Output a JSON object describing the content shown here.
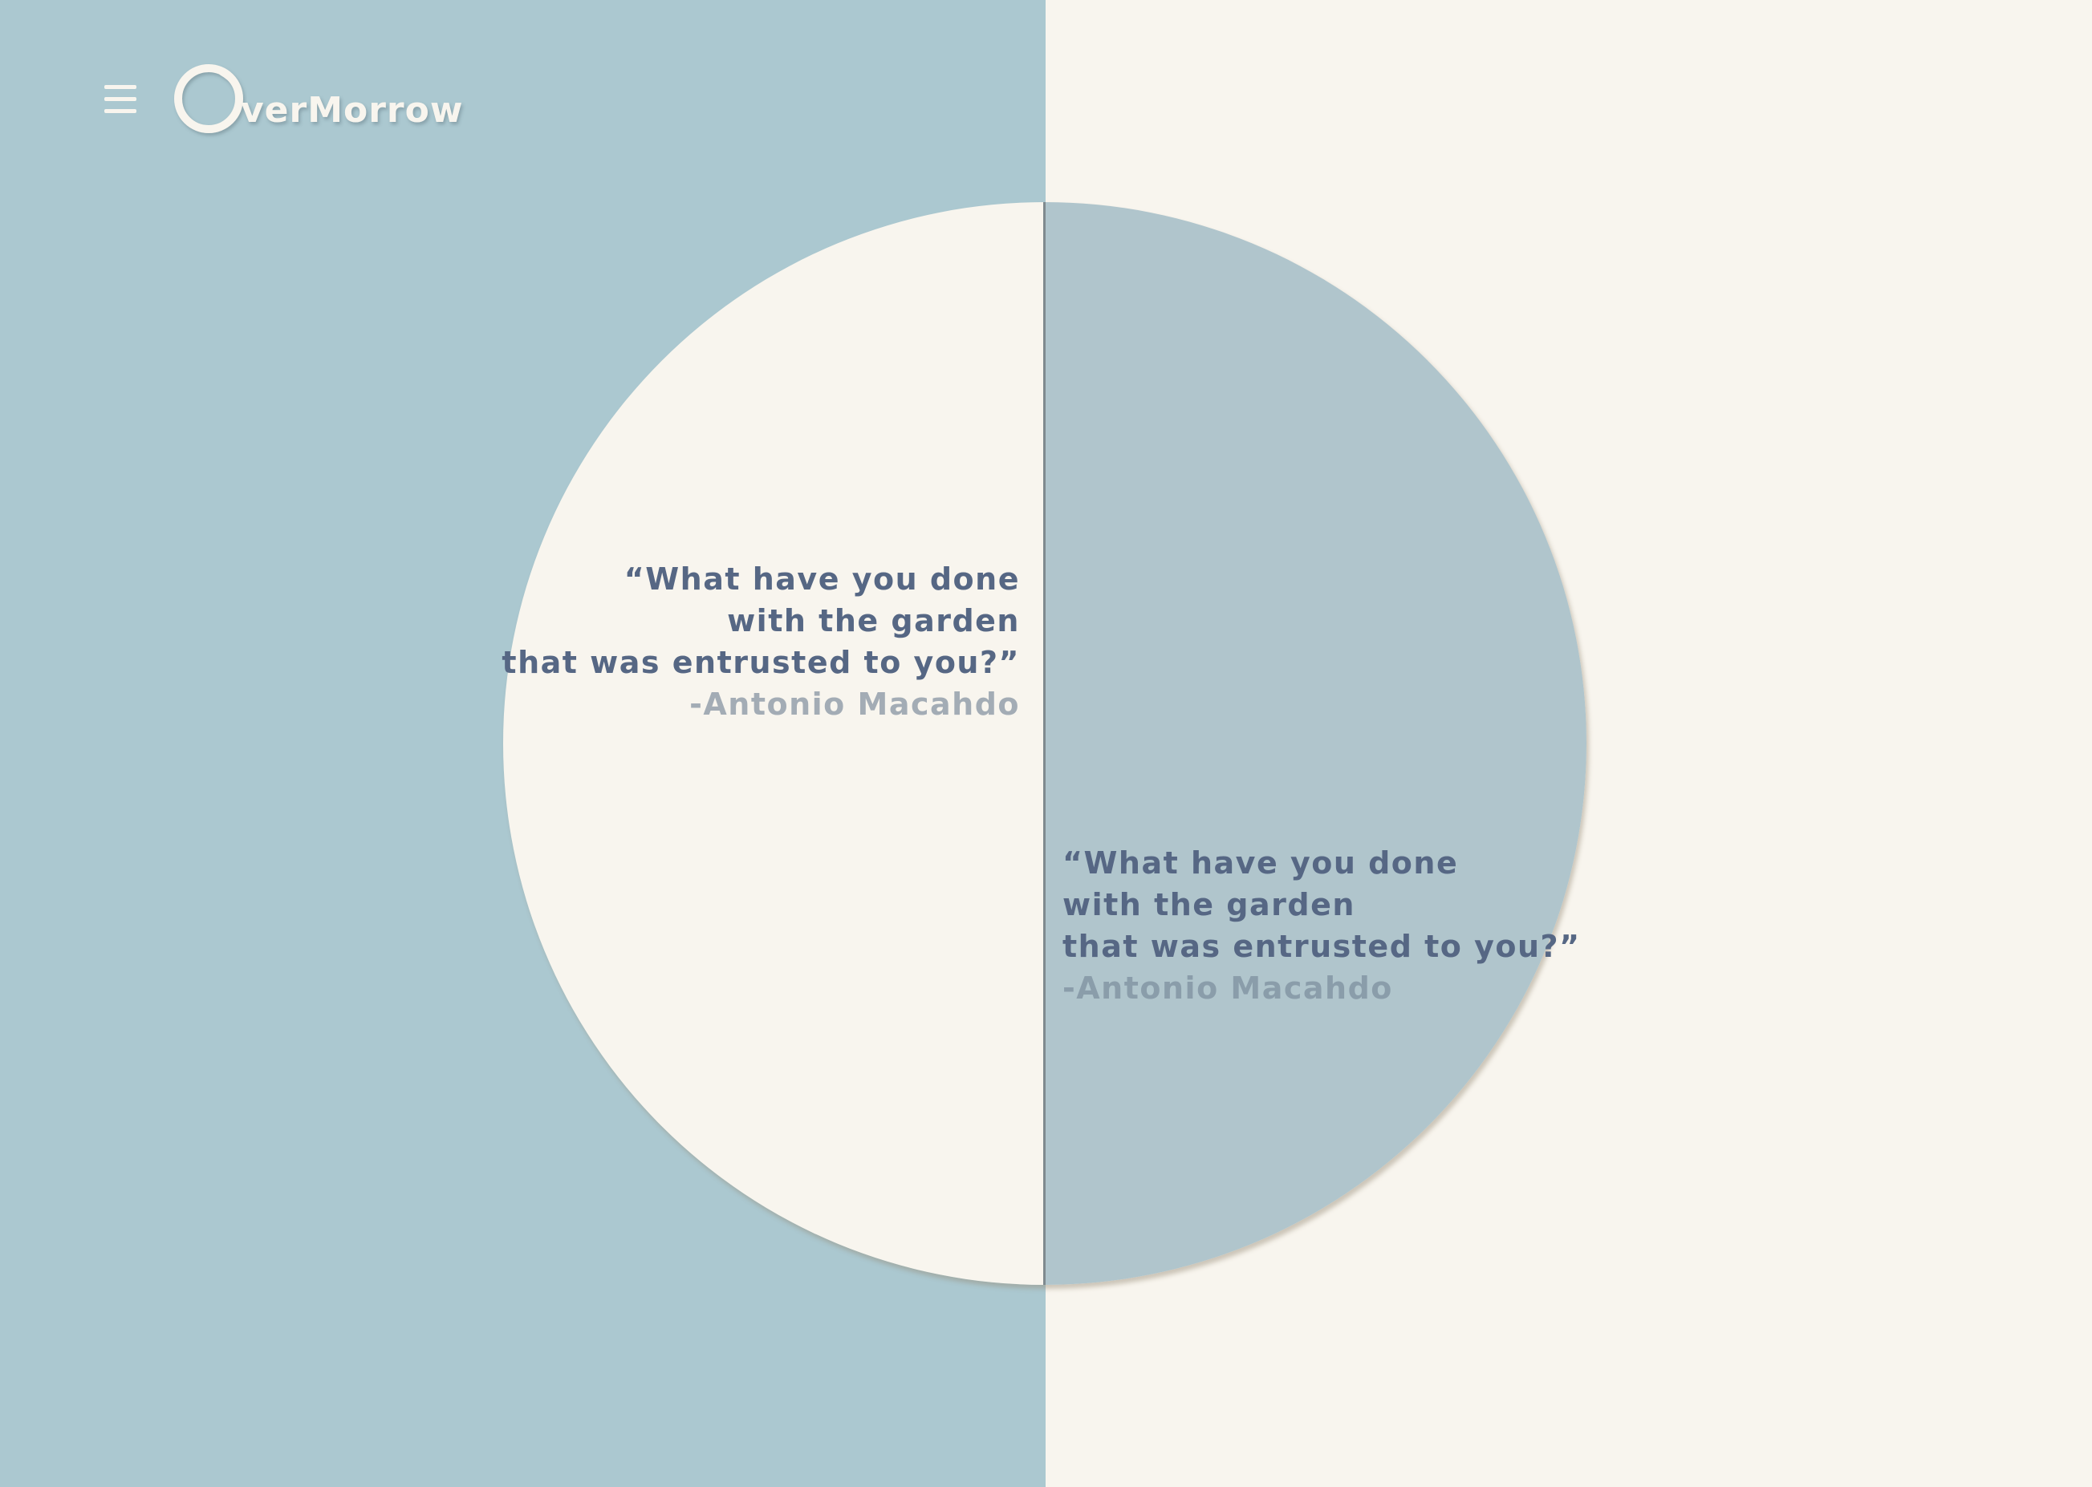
{
  "brand": {
    "name": "OverMorrow",
    "logo_text": "verMorrow"
  },
  "header": {
    "menu_icon": "hamburger-menu-icon"
  },
  "colors": {
    "left_panel": "#abc8d0",
    "right_panel": "#f8f5ee",
    "circle_right": "#b0c5cc",
    "quote_text": "#566784",
    "author_left": "#a3acb5",
    "author_right": "#8a9daa"
  },
  "quotes": [
    {
      "lines": [
        "“What have you done",
        "with the garden",
        "that was entrusted to you?”"
      ],
      "author": "-Antonio Macahdo"
    },
    {
      "lines": [
        "“What have you done",
        "with the garden",
        "that was entrusted to you?”"
      ],
      "author": "-Antonio Macahdo"
    }
  ]
}
